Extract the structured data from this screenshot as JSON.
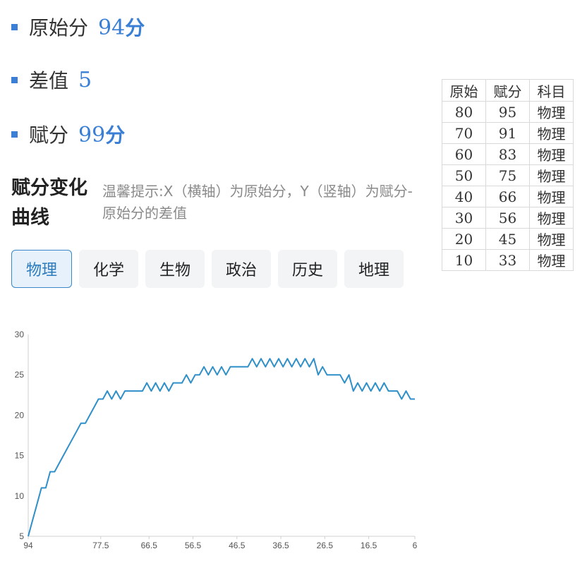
{
  "stats": [
    {
      "label": "原始分",
      "number": "94",
      "unit": "分"
    },
    {
      "label": "差值",
      "number": "5",
      "unit": ""
    },
    {
      "label": "赋分",
      "number": "99",
      "unit": "分"
    }
  ],
  "curve": {
    "title": "赋分变化曲线",
    "tip": "温馨提示:X（横轴）为原始分，Y（竖轴）为赋分-原始分的差值"
  },
  "tabs": [
    "物理",
    "化学",
    "生物",
    "政治",
    "历史",
    "地理"
  ],
  "active_tab": "物理",
  "table": {
    "headers": [
      "原始",
      "赋分",
      "科目"
    ],
    "rows": [
      [
        "80",
        "95",
        "物理"
      ],
      [
        "70",
        "91",
        "物理"
      ],
      [
        "60",
        "83",
        "物理"
      ],
      [
        "50",
        "75",
        "物理"
      ],
      [
        "40",
        "66",
        "物理"
      ],
      [
        "30",
        "56",
        "物理"
      ],
      [
        "20",
        "45",
        "物理"
      ],
      [
        "10",
        "33",
        "物理"
      ]
    ]
  },
  "colors": {
    "accent": "#3a7fd5",
    "line": "#2f8fc9",
    "active_tab_bg": "#e6f1fb"
  },
  "chart_data": {
    "type": "line",
    "title": "",
    "xlabel": "",
    "ylabel": "",
    "x_reversed": true,
    "xlim": [
      94,
      6
    ],
    "ylim": [
      5,
      30
    ],
    "x_ticks": [
      "94",
      "77.5",
      "66.5",
      "56.5",
      "46.5",
      "36.5",
      "26.5",
      "16.5",
      "6"
    ],
    "y_ticks": [
      "5",
      "10",
      "15",
      "20",
      "25",
      "30"
    ],
    "grid": false,
    "series": [
      {
        "x": [
          94,
          93,
          92,
          91,
          90,
          89,
          88,
          87,
          86,
          85,
          84,
          83,
          82,
          81,
          80,
          79,
          78,
          77,
          76,
          75,
          74,
          73,
          72,
          71,
          70,
          69,
          68,
          67,
          66,
          65,
          64,
          63,
          62,
          61,
          60,
          59,
          58,
          57,
          56,
          55,
          54,
          53,
          52,
          51,
          50,
          49,
          48,
          47,
          46,
          45,
          44,
          43,
          42,
          41,
          40,
          39,
          38,
          37,
          36,
          35,
          34,
          33,
          32,
          31,
          30,
          29,
          28,
          27,
          26,
          25,
          24,
          23,
          22,
          21,
          20,
          19,
          18,
          17,
          16,
          15,
          14,
          13,
          12,
          11,
          10,
          9,
          8,
          7,
          6
        ],
        "y": [
          5,
          7,
          9,
          11,
          11,
          13,
          13,
          14,
          15,
          16,
          17,
          18,
          19,
          19,
          20,
          21,
          22,
          22,
          23,
          22,
          23,
          22,
          23,
          23,
          23,
          23,
          23,
          24,
          23,
          24,
          23,
          24,
          23,
          24,
          24,
          24,
          25,
          24,
          25,
          25,
          26,
          25,
          26,
          25,
          26,
          25,
          26,
          26,
          26,
          26,
          26,
          27,
          26,
          27,
          26,
          27,
          26,
          27,
          26,
          27,
          26,
          27,
          26,
          27,
          26,
          27,
          25,
          26,
          25,
          25,
          25,
          25,
          24,
          25,
          23,
          24,
          23,
          24,
          23,
          24,
          23,
          24,
          23,
          23,
          23,
          22,
          23,
          22,
          22
        ]
      }
    ]
  }
}
